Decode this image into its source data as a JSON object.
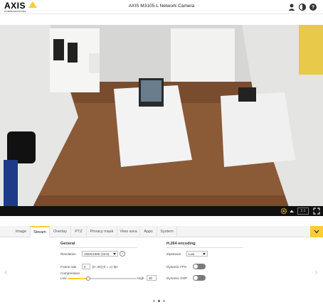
{
  "header": {
    "brand": "AXIS",
    "tagline": "COMMUNICATIONS",
    "title": "AXIS M3105-L Network Camera",
    "icons": [
      "user-icon",
      "contrast-icon",
      "help-icon"
    ]
  },
  "video": {
    "zoom_label": "1:1",
    "icons": [
      "settings-icon",
      "chevron-up-icon",
      "fullscreen-icon"
    ]
  },
  "tabs": [
    "Image",
    "Stream",
    "Overlay",
    "PTZ",
    "Privacy mask",
    "View area",
    "Apps",
    "System"
  ],
  "active_tab": "Stream",
  "general": {
    "title": "General",
    "resolution_label": "Resolution",
    "resolution_value": "1920x1080 (16:9)",
    "info_glyph": "i",
    "frame_rate_label": "Frame rate",
    "frame_rate_value": "0",
    "frame_rate_hint": "[0..30] (0 = ∞) fps",
    "compression_label": "Compression",
    "compression_low": "Low",
    "compression_high": "High",
    "compression_value": "30",
    "compression_fraction": 0.3
  },
  "h264": {
    "title": "H.264 encoding",
    "zipstream_label": "Zipstream",
    "zipstream_value": "Low",
    "dynamic_fps_label": "Dynamic FPS",
    "dynamic_gop_label": "Dynamic GOP"
  },
  "pager": {
    "count": 3,
    "active": 1
  },
  "colors": {
    "accent": "#ffcc33",
    "video_bg": "#000000",
    "toggle_off": "#7a7a7a"
  }
}
